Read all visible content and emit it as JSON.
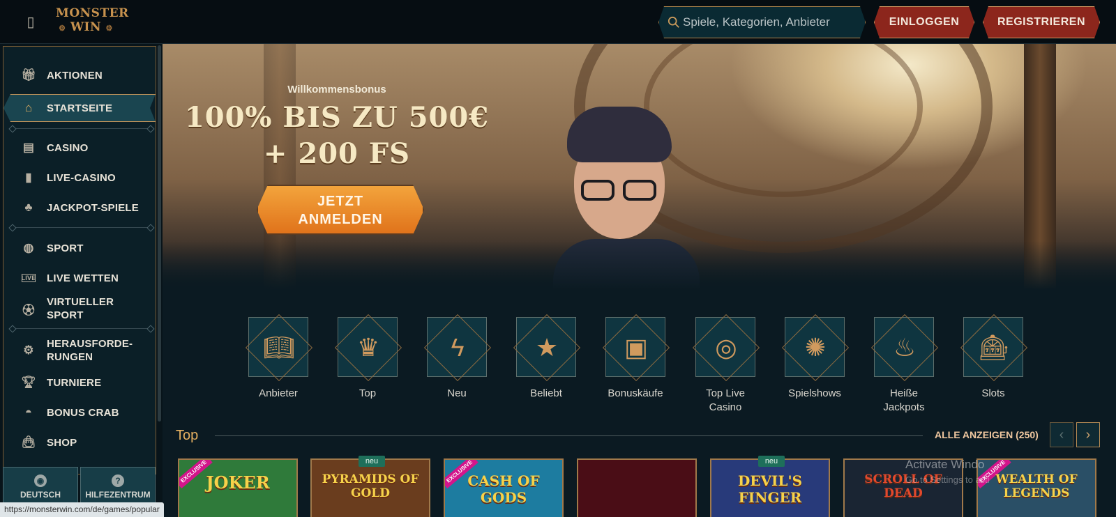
{
  "header": {
    "logo_line1": "MONSTER",
    "logo_line2": "WIN",
    "search_placeholder": "Spiele, Kategorien, Anbieter",
    "login_label": "EINLOGGEN",
    "register_label": "REGISTRIEREN"
  },
  "sidebar": {
    "items": [
      {
        "label": "AKTIONEN",
        "icon": "gift-icon"
      },
      {
        "label": "STARTSEITE",
        "icon": "home-icon"
      },
      {
        "label": "CASINO",
        "icon": "slot-machine-icon"
      },
      {
        "label": "LIVE-CASINO",
        "icon": "card-icon"
      },
      {
        "label": "JACKPOT-SPIELE",
        "icon": "clover-icon"
      },
      {
        "label": "SPORT",
        "icon": "basketball-icon"
      },
      {
        "label": "LIVE WETTEN",
        "icon": "live-icon"
      },
      {
        "label": "VIRTUELLER SPORT",
        "icon": "virtual-sport-icon"
      },
      {
        "label": "HERAUSFORDE-RUNGEN",
        "icon": "challenge-icon"
      },
      {
        "label": "TURNIERE",
        "icon": "trophy-icon"
      },
      {
        "label": "BONUS CRAB",
        "icon": "crab-icon"
      },
      {
        "label": "SHOP",
        "icon": "bag-icon"
      }
    ],
    "language_label": "DEUTSCH",
    "help_label": "HILFEZENTRUM",
    "status_url": "https://monsterwin.com/de/games/popular"
  },
  "hero": {
    "subtitle": "Willkommensbonus",
    "title_line1": "100% BIS ZU 500€",
    "title_line2": "+ 200 FS",
    "cta_line1": "JETZT",
    "cta_line2": "ANMELDEN"
  },
  "categories": [
    {
      "label": "Anbieter",
      "icon": "book-icon"
    },
    {
      "label": "Top",
      "icon": "crown-icon"
    },
    {
      "label": "Neu",
      "icon": "lightning-icon"
    },
    {
      "label": "Beliebt",
      "icon": "star-icon"
    },
    {
      "label": "Bonuskäufe",
      "icon": "chest-icon"
    },
    {
      "label": "Top Live Casino",
      "icon": "chip-icon"
    },
    {
      "label": "Spielshows",
      "icon": "wheel-icon"
    },
    {
      "label": "Heiße Jackpots",
      "icon": "flame-icon"
    },
    {
      "label": "Slots",
      "icon": "slot-icon"
    }
  ],
  "top_section": {
    "title": "Top",
    "view_all": "ALLE ANZEIGEN (250)"
  },
  "games": [
    {
      "title": "JOKER",
      "badge": "EXCLUSIVE",
      "bg": "#2f7a3a"
    },
    {
      "title": "PYRAMIDS OF GOLD",
      "badge": "neu",
      "bg": "#6a3d1e"
    },
    {
      "title": "CASH OF GODS",
      "badge": "EXCLUSIVE",
      "bg": "#1d7ca0"
    },
    {
      "title": "",
      "badge": "",
      "bg": "#4a0d16"
    },
    {
      "title": "DEVIL'S FINGER",
      "badge": "neu",
      "bg": "#283a7a"
    },
    {
      "title": "SCROLL OF DEAD",
      "badge": "",
      "bg": "#1a2533"
    },
    {
      "title": "WEALTH OF LEGENDS",
      "badge": "EXCLUSIVE",
      "bg": "#2a4f66"
    }
  ],
  "overlay": {
    "watermark": "Activate Windo",
    "watermark_sub": "Go to Settings to acti"
  }
}
